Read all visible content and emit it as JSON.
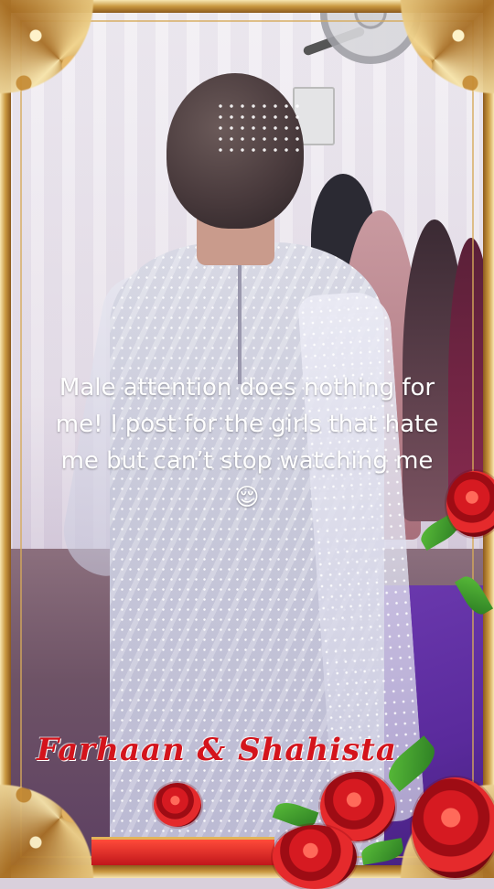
{
  "caption": {
    "text": "Male attention does nothing for me! I post for the girls that hate me but can’t stop watching me 😌"
  },
  "overlay": {
    "names": "Farhaan & Shahista"
  },
  "colors": {
    "frame_gold": "#c9973f",
    "rose_red": "#d61a21",
    "names_red": "#d4141c",
    "caption_white": "#ffffff"
  }
}
